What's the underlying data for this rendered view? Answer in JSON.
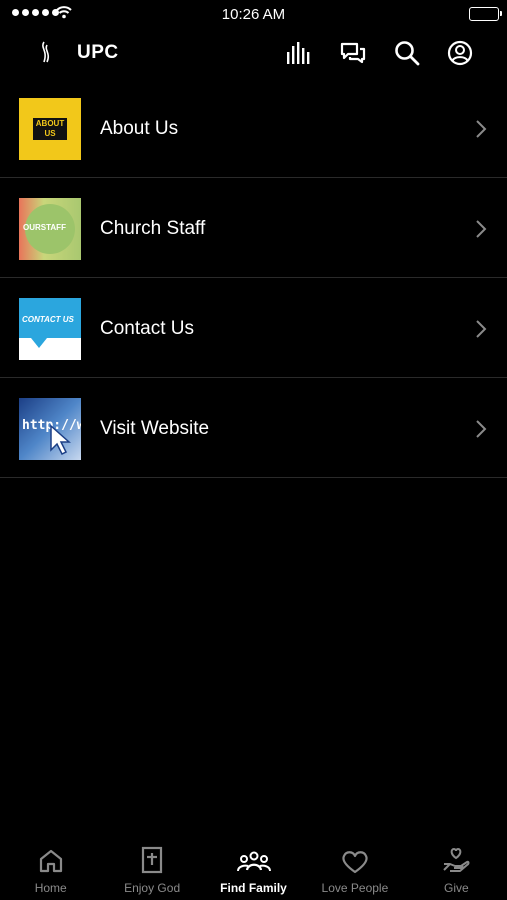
{
  "status_bar": {
    "time": "10:26 AM"
  },
  "nav": {
    "title": "UPC",
    "icons": [
      "audio-bars-icon",
      "chat-bubbles-icon",
      "search-icon",
      "profile-icon"
    ]
  },
  "menu": {
    "items": [
      {
        "label": "About Us",
        "thumb_text": "ABOUT US",
        "icon": "chevron-right-icon"
      },
      {
        "label": "Church Staff",
        "thumb_text": "OURSTAFF",
        "icon": "chevron-right-icon"
      },
      {
        "label": "Contact Us",
        "thumb_text": "CONTACT US",
        "icon": "chevron-right-icon"
      },
      {
        "label": "Visit Website",
        "thumb_text": "http://ww",
        "icon": "chevron-right-icon"
      }
    ]
  },
  "tabs": [
    {
      "label": "Home",
      "icon": "home-icon"
    },
    {
      "label": "Enjoy God",
      "icon": "bible-icon"
    },
    {
      "label": "Find Family",
      "icon": "people-icon",
      "active": true
    },
    {
      "label": "Love People",
      "icon": "heart-icon"
    },
    {
      "label": "Give",
      "icon": "give-hand-icon"
    }
  ],
  "colors": {
    "background": "#000000",
    "divider": "#2a2a2a",
    "inactive_tab": "#8a8a8a",
    "active_tab": "#ffffff"
  }
}
